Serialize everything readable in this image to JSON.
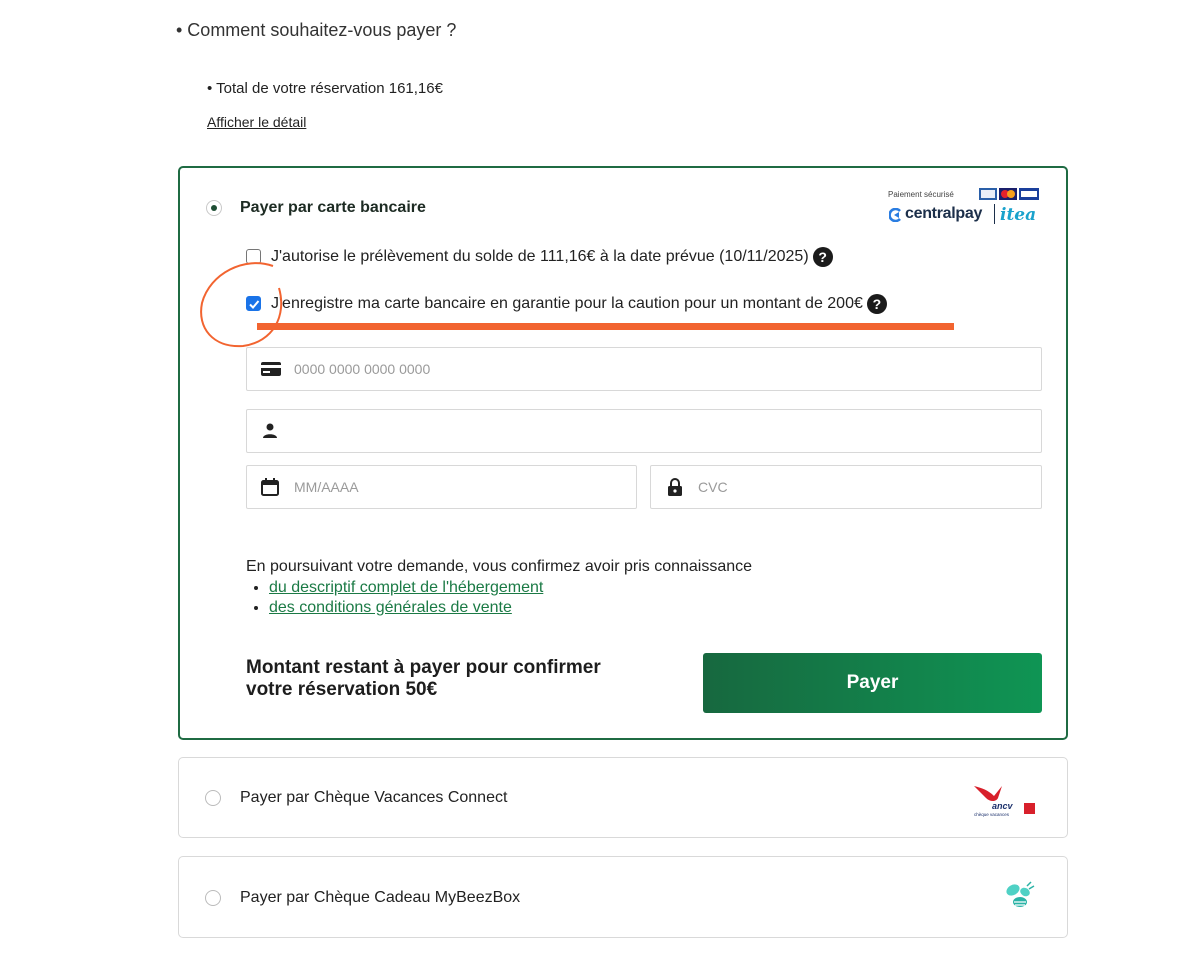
{
  "heading": "• Comment souhaitez-vous payer ?",
  "total": "• Total de votre réservation 161,16€",
  "detail_link": "Afficher le détail",
  "card_option": {
    "label": "Payer par carte bancaire",
    "secure_text": "Paiement sécurisé",
    "provider_logo": "centralpay",
    "partner_logo": "itea",
    "checkbox_balance": "J'autorise le prélèvement du solde de 111,16€ à la date prévue (10/11/2025)",
    "checkbox_deposit": "J'enregistre ma carte bancaire en garantie pour la caution pour un montant de 200€",
    "help_symbol": "?",
    "card_number_placeholder": "0000 0000 0000 0000",
    "name_placeholder": "",
    "expiry_placeholder": "MM/AAAA",
    "cvc_placeholder": "CVC",
    "legal_intro": "En poursuivant votre demande, vous confirmez avoir pris connaissance",
    "legal_links": [
      "du descriptif complet de l'hébergement",
      "des conditions générales de vente"
    ],
    "remaining": "Montant restant à payer pour confirmer votre réservation 50€",
    "pay_button": "Payer"
  },
  "cheque_option": {
    "label": "Payer par Chèque Vacances Connect",
    "logo": "ancv",
    "logo_sub": "chèque vacances"
  },
  "beez_option": {
    "label": "Payer par Chèque Cadeau MyBeezBox"
  },
  "colors": {
    "primary_green": "#1f6b43",
    "button_green": "#0f9554",
    "annotation": "#f26430",
    "checkbox_blue": "#1a73e8"
  }
}
